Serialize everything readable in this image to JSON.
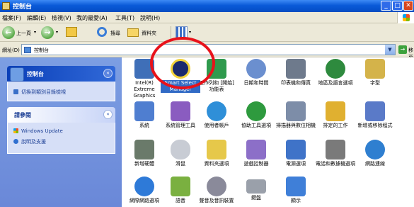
{
  "window": {
    "title": "控制台",
    "minimize": "_",
    "maximize": "□",
    "close": "✕"
  },
  "menubar": {
    "items": [
      "檔案(F)",
      "編輯(E)",
      "檢視(V)",
      "我的最愛(A)",
      "工具(T)",
      "說明(H)"
    ]
  },
  "toolbar": {
    "back": "上一頁",
    "search": "搜尋",
    "folders": "資料夾"
  },
  "addressbar": {
    "label": "網址(D)",
    "value": "控制台",
    "go": "移至"
  },
  "sidebar": {
    "panel1": {
      "title": "控制台",
      "links": [
        "切換到類別目錄檢視"
      ]
    },
    "panel2": {
      "title": "請參閱",
      "links": [
        "Windows Update",
        "說明及支援"
      ]
    }
  },
  "content": {
    "items": [
      {
        "label": "Intel(R) Extreme Graphics",
        "icon": "intel-graphics-icon",
        "color": "#3f6fb8"
      },
      {
        "label": "Smart Select Manager",
        "icon": "smart-select-icon",
        "color": "#1b2a6e"
      },
      {
        "label": "工作列和 [開始] 功能表",
        "icon": "taskbar-icon",
        "color": "#2f9a4d"
      },
      {
        "label": "日期和時間",
        "icon": "datetime-icon",
        "color": "#6b8fcf"
      },
      {
        "label": "印表機和傳真",
        "icon": "printer-icon",
        "color": "#6e7a8c"
      },
      {
        "label": "地區及語言選項",
        "icon": "globe-icon",
        "color": "#2e8a3e"
      },
      {
        "label": "字型",
        "icon": "fonts-icon",
        "color": "#d4b34a"
      },
      {
        "label": "系統",
        "icon": "system-icon",
        "color": "#4f7ed0"
      },
      {
        "label": "系統管理工具",
        "icon": "admin-tools-icon",
        "color": "#8a5cc0"
      },
      {
        "label": "使用者帳戶",
        "icon": "user-accounts-icon",
        "color": "#2f8fd8"
      },
      {
        "label": "協助工具選項",
        "icon": "accessibility-icon",
        "color": "#2e9a3e"
      },
      {
        "label": "掃描器與數位相機",
        "icon": "scanner-icon",
        "color": "#7d8da8"
      },
      {
        "label": "排定的工作",
        "icon": "scheduled-tasks-icon",
        "color": "#e0b030"
      },
      {
        "label": "新增或移除程式",
        "icon": "add-remove-icon",
        "color": "#5a7ac8"
      },
      {
        "label": "新增硬體",
        "icon": "add-hardware-icon",
        "color": "#6a7a6a"
      },
      {
        "label": "滑鼠",
        "icon": "mouse-icon",
        "color": "#c8ccd4"
      },
      {
        "label": "資料夾選項",
        "icon": "folder-options-icon",
        "color": "#e6c84a"
      },
      {
        "label": "遊戲控制器",
        "icon": "game-controller-icon",
        "color": "#8c6fc8"
      },
      {
        "label": "電源選項",
        "icon": "power-icon",
        "color": "#3f73c8"
      },
      {
        "label": "電話和數據機選項",
        "icon": "phone-modem-icon",
        "color": "#7a7a7a"
      },
      {
        "label": "網路連線",
        "icon": "network-icon",
        "color": "#2f7fd0"
      },
      {
        "label": "網際網路選項",
        "icon": "internet-options-icon",
        "color": "#2e7ad8"
      },
      {
        "label": "語音",
        "icon": "speech-icon",
        "color": "#7ab040"
      },
      {
        "label": "聲音及音訊裝置",
        "icon": "sound-icon",
        "color": "#8a8a9a"
      },
      {
        "label": "鍵盤",
        "icon": "keyboard-icon",
        "color": "#9aa0aa"
      },
      {
        "label": "顯示",
        "icon": "display-icon",
        "color": "#3f7fd8"
      }
    ]
  }
}
